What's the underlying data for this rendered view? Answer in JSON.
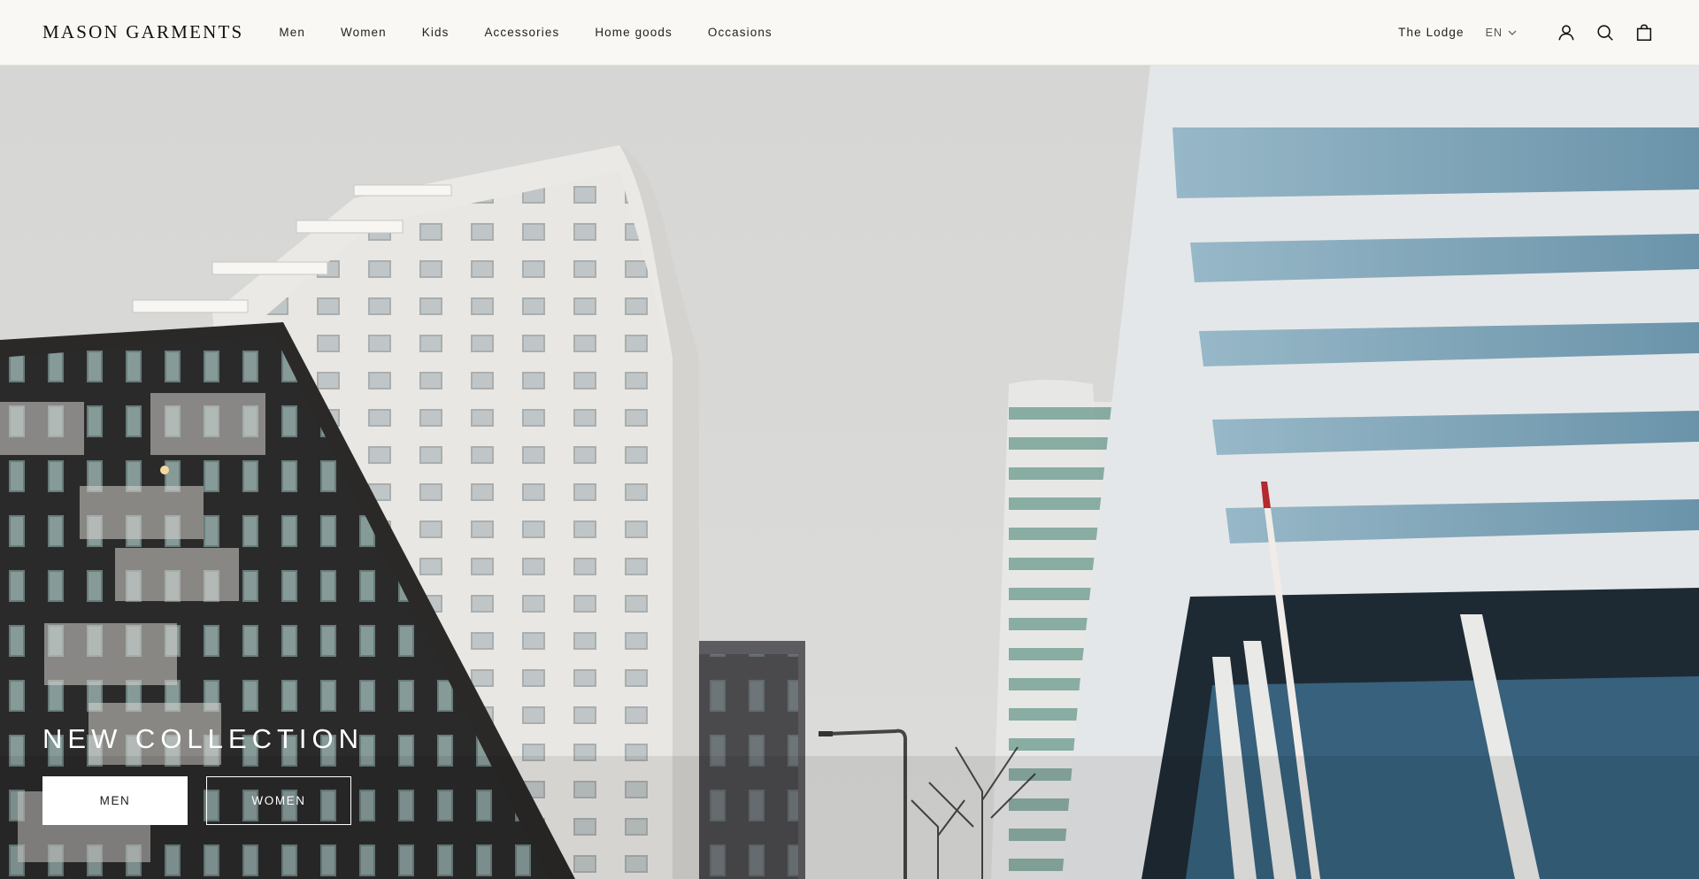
{
  "brand": {
    "name": "MASON GARMENTS"
  },
  "nav": {
    "items": [
      {
        "label": "Men"
      },
      {
        "label": "Women"
      },
      {
        "label": "Kids"
      },
      {
        "label": "Accessories"
      },
      {
        "label": "Home goods"
      },
      {
        "label": "Occasions"
      }
    ]
  },
  "header": {
    "store_label": "The Lodge",
    "language": "EN",
    "icons": [
      "account-icon",
      "search-icon",
      "cart-bag-icon"
    ]
  },
  "hero": {
    "title": "NEW COLLECTION",
    "primary_button": "MEN",
    "secondary_button": "WOMEN",
    "image_subject": "Low-angle view of modern high-rise apartment and office buildings under a grey sky"
  },
  "colors": {
    "header_bg": "#faf8f4",
    "text": "#1c1c1c",
    "button_light": "#ffffff"
  }
}
